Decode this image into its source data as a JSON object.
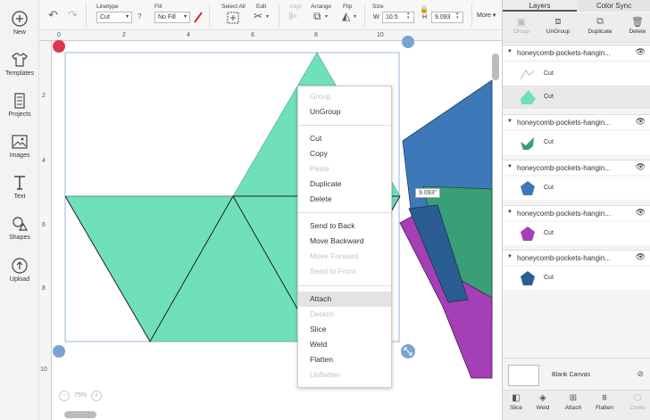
{
  "leftbar": {
    "items": [
      {
        "label": "New",
        "icon": "plus-circle-icon"
      },
      {
        "label": "Templates",
        "icon": "tshirt-icon"
      },
      {
        "label": "Projects",
        "icon": "projects-icon"
      },
      {
        "label": "Images",
        "icon": "image-icon"
      },
      {
        "label": "Text",
        "icon": "text-T-icon"
      },
      {
        "label": "Shapes",
        "icon": "shapes-icon"
      },
      {
        "label": "Upload",
        "icon": "upload-icon"
      }
    ]
  },
  "toolbar": {
    "linetype_label": "Linetype",
    "linetype_value": "Cut",
    "fill_label": "Fill",
    "fill_value": "No Fill",
    "help": "?",
    "select_all_label": "Select All",
    "edit_label": "Edit",
    "align_label": "Align",
    "arrange_label": "Arrange",
    "flip_label": "Flip",
    "size_label": "Size",
    "w_label": "W",
    "w_value": "10.5",
    "h_label": "H",
    "h_value": "9.093",
    "more_label": "More"
  },
  "rulers": {
    "top": [
      "0",
      "2",
      "4",
      "6",
      "8",
      "10"
    ],
    "left": [
      "2",
      "4",
      "6",
      "8",
      "10"
    ]
  },
  "canvas": {
    "dimension_tooltip": "9.093\"",
    "zoom": "75%",
    "colors": {
      "mint": "#6fe0bb",
      "blue": "#3d79b8",
      "green": "#3a9e76",
      "purple": "#a53fb6"
    }
  },
  "context_menu": {
    "groups": [
      [
        {
          "label": "Group",
          "enabled": false
        },
        {
          "label": "UnGroup",
          "enabled": true
        }
      ],
      [
        {
          "label": "Cut",
          "enabled": true
        },
        {
          "label": "Copy",
          "enabled": true
        },
        {
          "label": "Paste",
          "enabled": false
        },
        {
          "label": "Duplicate",
          "enabled": true
        },
        {
          "label": "Delete",
          "enabled": true
        }
      ],
      [
        {
          "label": "Send to Back",
          "enabled": true
        },
        {
          "label": "Move Backward",
          "enabled": true
        },
        {
          "label": "Move Forward",
          "enabled": false
        },
        {
          "label": "Send to Front",
          "enabled": false
        }
      ],
      [
        {
          "label": "Attach",
          "enabled": true,
          "hovered": true
        },
        {
          "label": "Detach",
          "enabled": false
        },
        {
          "label": "Slice",
          "enabled": true
        },
        {
          "label": "Weld",
          "enabled": true
        },
        {
          "label": "Flatten",
          "enabled": true
        },
        {
          "label": "Unflatten",
          "enabled": false
        }
      ]
    ]
  },
  "panel": {
    "tabs": [
      "Layers",
      "Color Sync"
    ],
    "active_tab": "Layers",
    "tools": [
      {
        "label": "Group",
        "enabled": false
      },
      {
        "label": "UnGroup",
        "enabled": true
      },
      {
        "label": "Duplicate",
        "enabled": true
      },
      {
        "label": "Delete",
        "enabled": true
      }
    ],
    "layers": [
      {
        "name": "honeycomb-pockets-hangin...",
        "items": [
          {
            "op": "Cut",
            "thumb": "outline"
          },
          {
            "op": "Cut",
            "thumb": "mint",
            "selected": true
          }
        ]
      },
      {
        "name": "honeycomb-pockets-hangin...",
        "items": [
          {
            "op": "Cut",
            "thumb": "green"
          }
        ]
      },
      {
        "name": "honeycomb-pockets-hangin...",
        "items": [
          {
            "op": "Cut",
            "thumb": "blue"
          }
        ]
      },
      {
        "name": "honeycomb-pockets-hangin...",
        "items": [
          {
            "op": "Cut",
            "thumb": "purple"
          }
        ]
      },
      {
        "name": "honeycomb-pockets-hangin...",
        "items": [
          {
            "op": "Cut",
            "thumb": "navy"
          }
        ]
      }
    ],
    "blank_canvas_label": "Blank Canvas",
    "bottom_tools": [
      "Slice",
      "Weld",
      "Attach",
      "Flatten",
      "Conto"
    ]
  }
}
